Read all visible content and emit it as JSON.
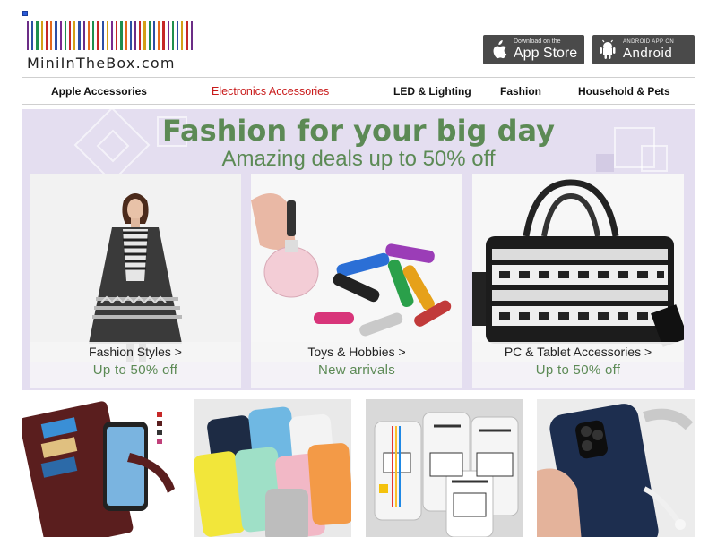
{
  "header": {
    "logo_text": "MiniInTheBox.com",
    "barcode_colors": [
      "#6b2d86",
      "#2c4fa3",
      "#1f8f4e",
      "#d4a017",
      "#c62828",
      "#e46a1b",
      "#2c4fa3",
      "#7a2b8f",
      "#1f8f4e",
      "#c62828",
      "#d4a017",
      "#2c4fa3",
      "#6b2d86",
      "#e46a1b",
      "#1f8f4e",
      "#c62828",
      "#2c4fa3",
      "#d4a017",
      "#7a2b8f",
      "#c62828",
      "#1f8f4e",
      "#e46a1b",
      "#2c4fa3",
      "#6b2d86",
      "#c62828",
      "#d4a017",
      "#1f8f4e",
      "#2c4fa3",
      "#e46a1b",
      "#c62828",
      "#7a2b8f",
      "#1f8f4e",
      "#2c4fa3",
      "#d4a017",
      "#c62828",
      "#6b2d86"
    ],
    "app_store": {
      "small": "Download on the",
      "big": "App Store"
    },
    "android": {
      "small": "ANDROID APP ON",
      "big": "Android"
    }
  },
  "nav": {
    "items": [
      {
        "label": "Apple Accessories"
      },
      {
        "label": "Electronics Accessories",
        "active": true
      },
      {
        "label": "LED & Lighting"
      },
      {
        "label": "Fashion"
      },
      {
        "label": "Household & Pets"
      }
    ],
    "active_color": "#c81a1a"
  },
  "banner": {
    "headline": "Fashion for your big day",
    "subline": "Amazing deals up to 50% off",
    "accent_color": "#5c8a55",
    "cards": [
      {
        "caption": "Fashion Styles >",
        "deal": "Up to 50% off"
      },
      {
        "caption": "Toys & Hobbies >",
        "deal": "New arrivals"
      },
      {
        "caption": "PC & Tablet Accessories >",
        "deal": "Up to 50% off"
      }
    ]
  },
  "products": [
    {
      "name": "leather-wallet-phone-case"
    },
    {
      "name": "colorful-silicone-phone-cases"
    },
    {
      "name": "city-ticket-phone-cases"
    },
    {
      "name": "navy-fabric-phone-case"
    }
  ]
}
